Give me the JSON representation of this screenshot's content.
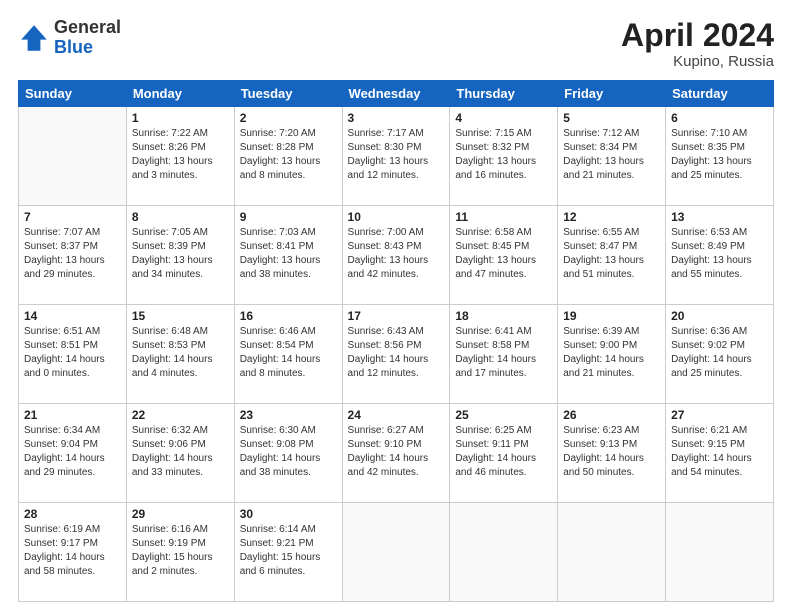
{
  "logo": {
    "general": "General",
    "blue": "Blue"
  },
  "title": {
    "month": "April 2024",
    "location": "Kupino, Russia"
  },
  "headers": [
    "Sunday",
    "Monday",
    "Tuesday",
    "Wednesday",
    "Thursday",
    "Friday",
    "Saturday"
  ],
  "weeks": [
    [
      {
        "day": "",
        "info": ""
      },
      {
        "day": "1",
        "info": "Sunrise: 7:22 AM\nSunset: 8:26 PM\nDaylight: 13 hours\nand 3 minutes."
      },
      {
        "day": "2",
        "info": "Sunrise: 7:20 AM\nSunset: 8:28 PM\nDaylight: 13 hours\nand 8 minutes."
      },
      {
        "day": "3",
        "info": "Sunrise: 7:17 AM\nSunset: 8:30 PM\nDaylight: 13 hours\nand 12 minutes."
      },
      {
        "day": "4",
        "info": "Sunrise: 7:15 AM\nSunset: 8:32 PM\nDaylight: 13 hours\nand 16 minutes."
      },
      {
        "day": "5",
        "info": "Sunrise: 7:12 AM\nSunset: 8:34 PM\nDaylight: 13 hours\nand 21 minutes."
      },
      {
        "day": "6",
        "info": "Sunrise: 7:10 AM\nSunset: 8:35 PM\nDaylight: 13 hours\nand 25 minutes."
      }
    ],
    [
      {
        "day": "7",
        "info": "Sunrise: 7:07 AM\nSunset: 8:37 PM\nDaylight: 13 hours\nand 29 minutes."
      },
      {
        "day": "8",
        "info": "Sunrise: 7:05 AM\nSunset: 8:39 PM\nDaylight: 13 hours\nand 34 minutes."
      },
      {
        "day": "9",
        "info": "Sunrise: 7:03 AM\nSunset: 8:41 PM\nDaylight: 13 hours\nand 38 minutes."
      },
      {
        "day": "10",
        "info": "Sunrise: 7:00 AM\nSunset: 8:43 PM\nDaylight: 13 hours\nand 42 minutes."
      },
      {
        "day": "11",
        "info": "Sunrise: 6:58 AM\nSunset: 8:45 PM\nDaylight: 13 hours\nand 47 minutes."
      },
      {
        "day": "12",
        "info": "Sunrise: 6:55 AM\nSunset: 8:47 PM\nDaylight: 13 hours\nand 51 minutes."
      },
      {
        "day": "13",
        "info": "Sunrise: 6:53 AM\nSunset: 8:49 PM\nDaylight: 13 hours\nand 55 minutes."
      }
    ],
    [
      {
        "day": "14",
        "info": "Sunrise: 6:51 AM\nSunset: 8:51 PM\nDaylight: 14 hours\nand 0 minutes."
      },
      {
        "day": "15",
        "info": "Sunrise: 6:48 AM\nSunset: 8:53 PM\nDaylight: 14 hours\nand 4 minutes."
      },
      {
        "day": "16",
        "info": "Sunrise: 6:46 AM\nSunset: 8:54 PM\nDaylight: 14 hours\nand 8 minutes."
      },
      {
        "day": "17",
        "info": "Sunrise: 6:43 AM\nSunset: 8:56 PM\nDaylight: 14 hours\nand 12 minutes."
      },
      {
        "day": "18",
        "info": "Sunrise: 6:41 AM\nSunset: 8:58 PM\nDaylight: 14 hours\nand 17 minutes."
      },
      {
        "day": "19",
        "info": "Sunrise: 6:39 AM\nSunset: 9:00 PM\nDaylight: 14 hours\nand 21 minutes."
      },
      {
        "day": "20",
        "info": "Sunrise: 6:36 AM\nSunset: 9:02 PM\nDaylight: 14 hours\nand 25 minutes."
      }
    ],
    [
      {
        "day": "21",
        "info": "Sunrise: 6:34 AM\nSunset: 9:04 PM\nDaylight: 14 hours\nand 29 minutes."
      },
      {
        "day": "22",
        "info": "Sunrise: 6:32 AM\nSunset: 9:06 PM\nDaylight: 14 hours\nand 33 minutes."
      },
      {
        "day": "23",
        "info": "Sunrise: 6:30 AM\nSunset: 9:08 PM\nDaylight: 14 hours\nand 38 minutes."
      },
      {
        "day": "24",
        "info": "Sunrise: 6:27 AM\nSunset: 9:10 PM\nDaylight: 14 hours\nand 42 minutes."
      },
      {
        "day": "25",
        "info": "Sunrise: 6:25 AM\nSunset: 9:11 PM\nDaylight: 14 hours\nand 46 minutes."
      },
      {
        "day": "26",
        "info": "Sunrise: 6:23 AM\nSunset: 9:13 PM\nDaylight: 14 hours\nand 50 minutes."
      },
      {
        "day": "27",
        "info": "Sunrise: 6:21 AM\nSunset: 9:15 PM\nDaylight: 14 hours\nand 54 minutes."
      }
    ],
    [
      {
        "day": "28",
        "info": "Sunrise: 6:19 AM\nSunset: 9:17 PM\nDaylight: 14 hours\nand 58 minutes."
      },
      {
        "day": "29",
        "info": "Sunrise: 6:16 AM\nSunset: 9:19 PM\nDaylight: 15 hours\nand 2 minutes."
      },
      {
        "day": "30",
        "info": "Sunrise: 6:14 AM\nSunset: 9:21 PM\nDaylight: 15 hours\nand 6 minutes."
      },
      {
        "day": "",
        "info": ""
      },
      {
        "day": "",
        "info": ""
      },
      {
        "day": "",
        "info": ""
      },
      {
        "day": "",
        "info": ""
      }
    ]
  ]
}
